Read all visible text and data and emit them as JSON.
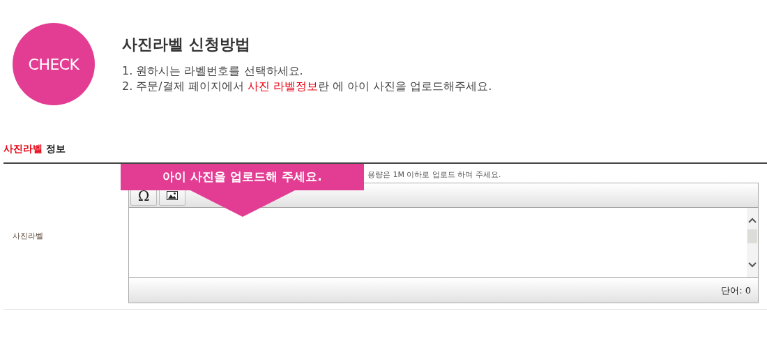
{
  "badge": "CHECK",
  "guide": {
    "title": "사진라벨 신청방법",
    "steps": [
      [
        {
          "text": "1. 원하시는 라벨번호를 선택하세요.",
          "highlight": false
        }
      ],
      [
        {
          "text": "2. 주문/결제 페이지에서 ",
          "highlight": false
        },
        {
          "text": "사진 라벨정보",
          "highlight": true
        },
        {
          "text": "란 에 아이 사진을 업로드해주세요.",
          "highlight": false
        }
      ]
    ]
  },
  "section": {
    "title": [
      {
        "text": "사진라벨",
        "highlight": true
      },
      {
        "text": " 정보",
        "highlight": false
      }
    ]
  },
  "row": {
    "label": "사진라벨",
    "hint": "용량은 1M 이하로 업로드 하여 주세요.",
    "callout": "아이 사진을 업로드해 주세요.",
    "toolbar": [
      "Ω"
    ],
    "word_count": "단어: 0"
  }
}
